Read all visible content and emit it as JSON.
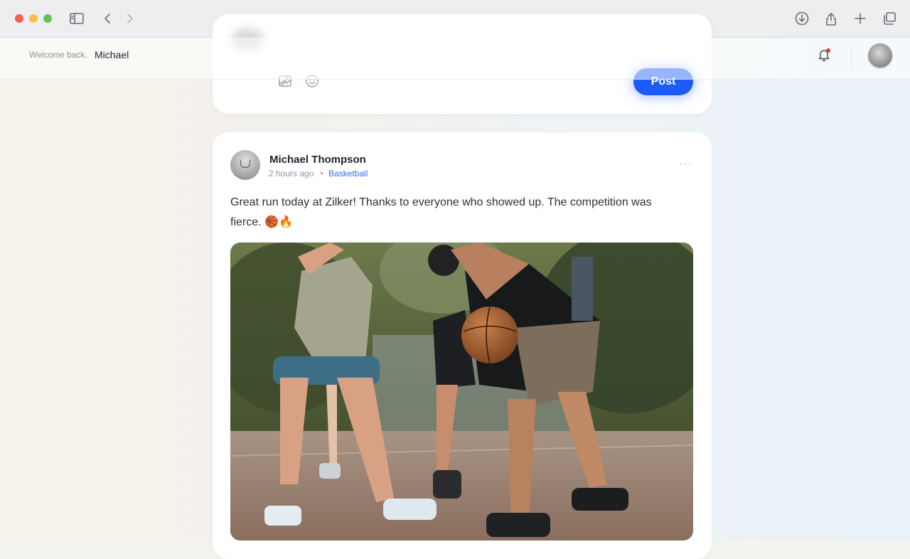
{
  "header": {
    "welcome_prefix": "Welcome back,",
    "user_name": "Michael"
  },
  "composer": {
    "post_label": "Post"
  },
  "post": {
    "author": "Michael Thompson",
    "time": "2 hours ago",
    "tag": "Basketball",
    "text": "Great run today at Zilker! Thanks to everyone who showed up. The competition was fierce. 🏀🔥",
    "more_label": "···"
  },
  "colors": {
    "accent": "#1a5cf5",
    "tag": "#2f6ce8",
    "notification_dot": "#f0322f"
  },
  "icons": {
    "sidebar": "sidebar-icon",
    "back": "chevron-left-icon",
    "forward": "chevron-right-icon",
    "download": "download-icon",
    "share": "share-icon",
    "new_tab": "plus-icon",
    "tabs": "tabs-overview-icon",
    "bell": "bell-icon",
    "image": "image-icon",
    "emoji": "emoji-icon",
    "more": "more-horizontal-icon"
  }
}
